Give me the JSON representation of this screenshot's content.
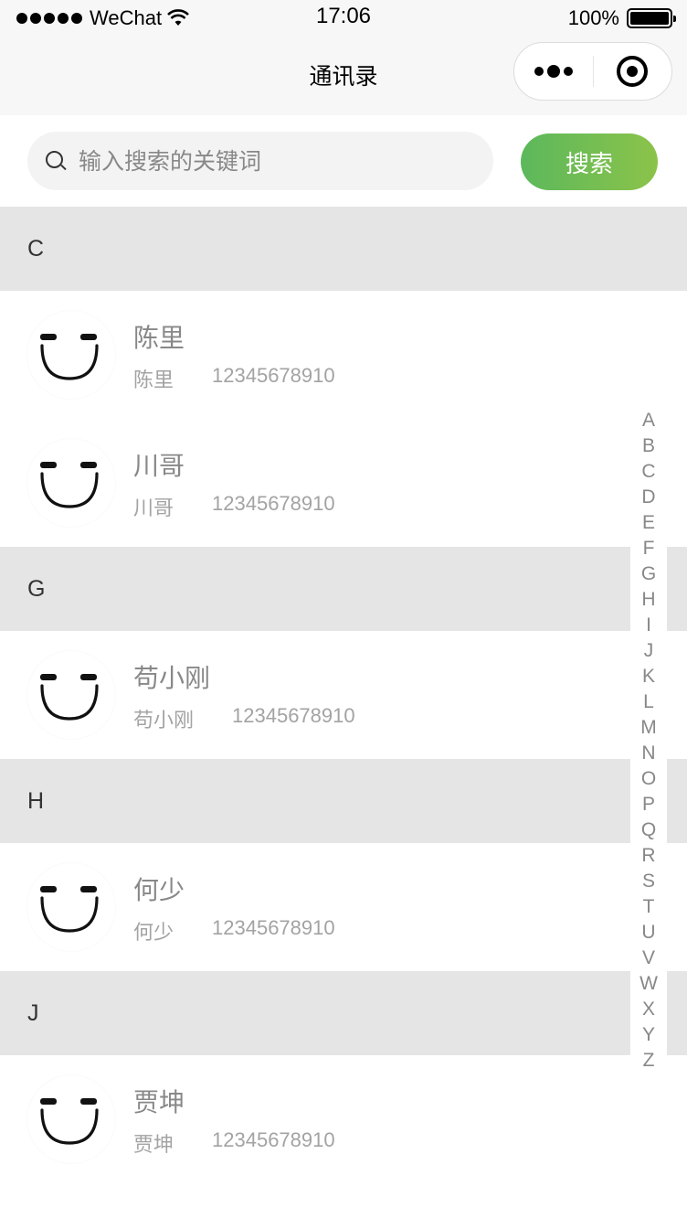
{
  "status_bar": {
    "carrier": "WeChat",
    "time": "17:06",
    "battery_percent": "100%",
    "battery_level": 1.0
  },
  "nav": {
    "title": "通讯录",
    "more_icon": "more-dots-icon",
    "close_icon": "target-circle-icon"
  },
  "search": {
    "placeholder": "输入搜索的关键词",
    "value": "",
    "button_label": "搜索",
    "button_colors": [
      "#5cb85c",
      "#8bc34a"
    ]
  },
  "sections": [
    {
      "letter": "C",
      "contacts": [
        {
          "name": "陈里",
          "nickname": "陈里",
          "phone": "12345678910",
          "avatar_icon": "smiley-avatar-icon"
        },
        {
          "name": "川哥",
          "nickname": "川哥",
          "phone": "12345678910",
          "avatar_icon": "smiley-avatar-icon"
        }
      ]
    },
    {
      "letter": "G",
      "contacts": [
        {
          "name": "苟小刚",
          "nickname": "苟小刚",
          "phone": "12345678910",
          "avatar_icon": "smiley-avatar-icon"
        }
      ]
    },
    {
      "letter": "H",
      "contacts": [
        {
          "name": "何少",
          "nickname": "何少",
          "phone": "12345678910",
          "avatar_icon": "smiley-avatar-icon"
        }
      ]
    },
    {
      "letter": "J",
      "contacts": [
        {
          "name": "贾坤",
          "nickname": "贾坤",
          "phone": "12345678910",
          "avatar_icon": "smiley-avatar-icon"
        }
      ]
    }
  ],
  "alphabet_index": [
    "A",
    "B",
    "C",
    "D",
    "E",
    "F",
    "G",
    "H",
    "I",
    "J",
    "K",
    "L",
    "M",
    "N",
    "O",
    "P",
    "Q",
    "R",
    "S",
    "T",
    "U",
    "V",
    "W",
    "X",
    "Y",
    "Z"
  ]
}
